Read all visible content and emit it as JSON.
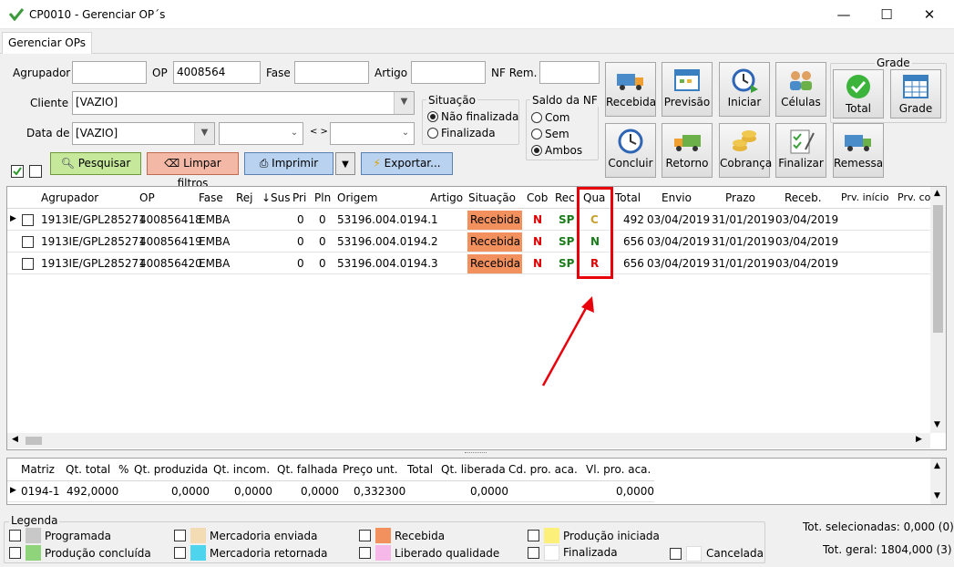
{
  "window": {
    "title": "CP0010 - Gerenciar OP´s",
    "minimize": "—",
    "maximize": "☐",
    "close": "✕"
  },
  "tabs": [
    {
      "label": "Gerenciar OPs"
    }
  ],
  "filters": {
    "agrupador_label": "Agrupador",
    "agrupador_value": "",
    "op_label": "OP",
    "op_value": "4008564",
    "fase_label": "Fase",
    "fase_value": "",
    "artigo_label": "Artigo",
    "artigo_value": "",
    "nfrem_label": "NF Rem.",
    "nfrem_value": "",
    "cliente_label": "Cliente",
    "cliente_value": "[VAZIO]",
    "datade_label": "Data de",
    "datade_value": "[VAZIO]",
    "date_sep": "< >",
    "situacao": {
      "title": "Situação",
      "options": [
        "Não finalizada",
        "Finalizada"
      ],
      "selected": "Não finalizada"
    },
    "saldo": {
      "title": "Saldo da NF",
      "options": [
        "Com",
        "Sem",
        "Ambos"
      ],
      "selected": "Ambos"
    },
    "grade_title": "Grade"
  },
  "toolbar": {
    "recebida": "Recebida",
    "previsao": "Previsão",
    "iniciar": "Iniciar",
    "celulas": "Células",
    "total": "Total",
    "grade": "Grade",
    "concluir": "Concluir",
    "retorno": "Retorno",
    "cobranca": "Cobrança",
    "finalizar": "Finalizar",
    "remessa": "Remessa"
  },
  "actions": {
    "pesquisar": "Pesquisar",
    "limpar": "Limpar filtros",
    "imprimir": "Imprimir",
    "exportar": "Exportar..."
  },
  "grid": {
    "columns": [
      "Agrupador",
      "OP",
      "Fase",
      "Rej",
      "↓Sus",
      "Pri",
      "Pln",
      "Origem",
      "Artigo",
      "Situação",
      "Cob",
      "Rec",
      "Qua",
      "Total",
      "Envio",
      "Prazo",
      "Receb.",
      "Prv. início",
      "Prv. con"
    ],
    "rows": [
      {
        "agrupador": "1913IE/GPL285271",
        "op": "400856418",
        "fase": "EMBA",
        "pri": "0",
        "pln": "0",
        "origem": "53196.004.0194.1",
        "situacao": "Recebida",
        "cob": "N",
        "rec": "SP",
        "qua": "C",
        "total": "492",
        "envio": "03/04/2019",
        "prazo": "31/01/2019",
        "receb": "03/04/2019"
      },
      {
        "agrupador": "1913IE/GPL285271",
        "op": "400856419",
        "fase": "EMBA",
        "pri": "0",
        "pln": "0",
        "origem": "53196.004.0194.2",
        "situacao": "Recebida",
        "cob": "N",
        "rec": "SP",
        "qua": "N",
        "total": "656",
        "envio": "03/04/2019",
        "prazo": "31/01/2019",
        "receb": "03/04/2019"
      },
      {
        "agrupador": "1913IE/GPL285271",
        "op": "400856420",
        "fase": "EMBA",
        "pri": "0",
        "pln": "0",
        "origem": "53196.004.0194.3",
        "situacao": "Recebida",
        "cob": "N",
        "rec": "SP",
        "qua": "R",
        "total": "656",
        "envio": "03/04/2019",
        "prazo": "31/01/2019",
        "receb": "03/04/2019"
      }
    ]
  },
  "detail": {
    "columns": [
      "Matriz",
      "Qt. total",
      "%",
      "Qt. produzida",
      "Qt. incom.",
      "Qt. falhada",
      "Preço unt.",
      "Total",
      "Qt. liberada",
      "Cd. pro. aca.",
      "Vl. pro. aca."
    ],
    "row": {
      "matriz": "0194-1",
      "qt_total": "492,0000",
      "qt_produzida": "0,0000",
      "qt_incom": "0,0000",
      "qt_falhada": "0,0000",
      "preco": "0,332300",
      "qt_liberada": "0,0000",
      "vl_pro": "0,0000"
    }
  },
  "legend": {
    "title": "Legenda",
    "items": [
      {
        "label": "Programada",
        "color": "#c8c8c8"
      },
      {
        "label": "Produção concluída",
        "color": "#8fd37a"
      },
      {
        "label": "Mercadoria enviada",
        "color": "#f3dcb4"
      },
      {
        "label": "Mercadoria retornada",
        "color": "#4fd4ee"
      },
      {
        "label": "Recebida",
        "color": "#f2905e"
      },
      {
        "label": "Liberado qualidade",
        "color": "#f5b8e8"
      },
      {
        "label": "Produção iniciada",
        "color": "#fdf07a"
      },
      {
        "label": "Finalizada",
        "color": "#ffffff"
      },
      {
        "label": "Cancelada",
        "color": "#ffffff"
      }
    ]
  },
  "totals": {
    "selecionadas": "Tot. selecionadas: 0,000 (0)",
    "geral": "Tot. geral: 1804,000 (3)"
  },
  "colors": {
    "qua_C": "#c9a12e",
    "qua_N": "#1a7d1a",
    "qua_R": "#e00000",
    "cob": "#e00000",
    "rec": "#1a7d1a",
    "highlight": "#e8000b"
  }
}
